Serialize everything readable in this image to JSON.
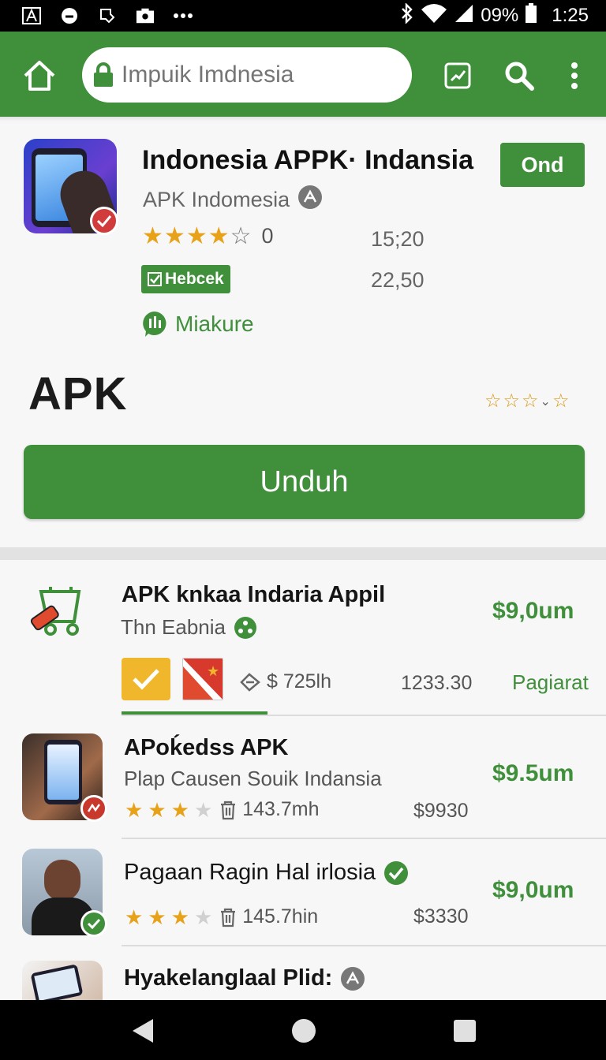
{
  "status_bar": {
    "battery": "09%",
    "time": "1:25"
  },
  "search": {
    "placeholder": "Impuik Imdnesia"
  },
  "hero": {
    "title": "Indonesia APPK· Indansia",
    "subtitle": "APK Indomesia",
    "open_label": "Ond",
    "rating_stars": 4,
    "rating_count": "0",
    "value1": "15;20",
    "badge_label": "Hebcek",
    "value2": "22,50",
    "tag_label": "Miakure",
    "big_label": "APK",
    "download_label": "Unduh"
  },
  "list": [
    {
      "title": "APK knkaa Indaria Appil",
      "subtitle": "Thn Eabnia",
      "price": "$9,0um",
      "meta_price": "$ 725lh",
      "amount": "1233.30",
      "tag": "Pagiarat"
    },
    {
      "title": "APoḱedss APK",
      "subtitle": "Plap Causen Souik Indansia",
      "price": "$9.5um",
      "stars": 3,
      "meta": "143.7mh",
      "amount": "$9930"
    },
    {
      "title": "Pagaan Ragin Hal irlosia",
      "price": "$9,0um",
      "stars": 3,
      "meta": "145.7hin",
      "amount": "$3330"
    },
    {
      "title": "Hyakelanglaal Plid:"
    }
  ],
  "colors": {
    "brand_green": "#3f8f3b",
    "star": "#e7a21a",
    "status_bar": "#000000"
  }
}
